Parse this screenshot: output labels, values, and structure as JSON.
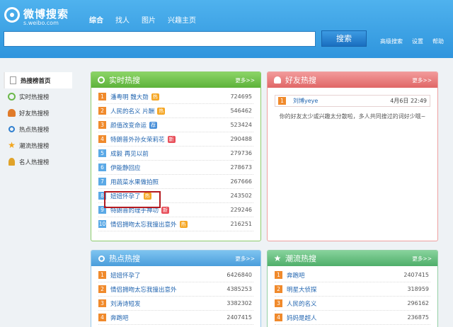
{
  "header": {
    "logo_text": "微博搜索",
    "logo_domain": "s.weibo.com",
    "nav": [
      "综合",
      "找人",
      "图片",
      "兴趣主页"
    ],
    "search_value": "",
    "search_button": "搜索",
    "links": [
      "高级搜索",
      "设置",
      "帮助"
    ],
    "colors": {
      "header_bg": "#3aa3e6"
    }
  },
  "sidebar": {
    "items": [
      {
        "label": "热搜榜首页",
        "icon": "document-icon"
      },
      {
        "label": "实时热搜榜",
        "icon": "clock-icon"
      },
      {
        "label": "好友热搜榜",
        "icon": "friends-icon"
      },
      {
        "label": "热点热搜榜",
        "icon": "search-icon"
      },
      {
        "label": "潮流热搜榜",
        "icon": "star-icon"
      },
      {
        "label": "名人热搜榜",
        "icon": "person-icon"
      }
    ]
  },
  "realtime": {
    "title": "实时热搜",
    "more": "更多>>",
    "rows": [
      {
        "rank": "1",
        "kw": "潘粤明 魏大勋",
        "badge": "热",
        "count": "724695"
      },
      {
        "rank": "2",
        "kw": "人民的名义 片酬",
        "badge": "热",
        "count": "546462"
      },
      {
        "rank": "3",
        "kw": "颜值改变命运",
        "badge": "荐",
        "count": "523424"
      },
      {
        "rank": "4",
        "kw": "特朗普外孙女荣莉花",
        "badge": "新",
        "count": "290488"
      },
      {
        "rank": "5",
        "kw": "成毅 再见以前",
        "badge": "",
        "count": "279736"
      },
      {
        "rank": "6",
        "kw": "伊能静回应",
        "badge": "",
        "count": "278673"
      },
      {
        "rank": "7",
        "kw": "用蔬菜水果做拍照",
        "badge": "",
        "count": "267666"
      },
      {
        "rank": "8",
        "kw": "妞妞怀孕了",
        "badge": "热",
        "count": "243502"
      },
      {
        "rank": "9",
        "kw": "特朗普的理手神功",
        "badge": "新",
        "count": "229246"
      },
      {
        "rank": "10",
        "kw": "情侣拥吻太忘我撞出意外",
        "badge": "热",
        "count": "216251"
      }
    ]
  },
  "friends": {
    "title": "好友热搜",
    "more": "更多>>",
    "rank": "1",
    "user": "刘博yeye",
    "date": "4月6日 22:49",
    "message": "你的好友太少或兴趣太分散啦，多人共同搜过的词好少哦~"
  },
  "hotspot": {
    "title": "热点热搜",
    "more": "更多>>",
    "rows": [
      {
        "rank": "1",
        "kw": "妞妞怀孕了",
        "count": "6426840"
      },
      {
        "rank": "2",
        "kw": "情侣拥吻太忘我撞出意外",
        "count": "4385253"
      },
      {
        "rank": "3",
        "kw": "刘涛诗短发",
        "count": "3382302"
      },
      {
        "rank": "4",
        "kw": "奔跑吧",
        "count": "2407415"
      }
    ]
  },
  "trend": {
    "title": "潮流热搜",
    "more": "更多>>",
    "rows": [
      {
        "rank": "1",
        "kw": "奔跑吧",
        "count": "2407415"
      },
      {
        "rank": "2",
        "kw": "明星大侦探",
        "count": "318959"
      },
      {
        "rank": "3",
        "kw": "人民的名义",
        "count": "296162"
      },
      {
        "rank": "4",
        "kw": "妈妈是超人",
        "count": "236875"
      }
    ]
  }
}
